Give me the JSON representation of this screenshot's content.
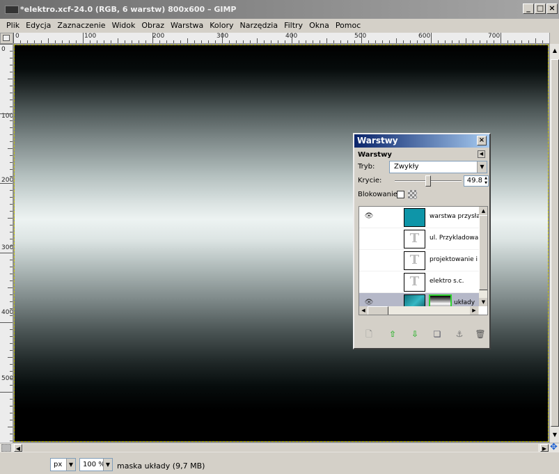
{
  "window": {
    "title": "*elektro.xcf-24.0 (RGB, 6 warstw) 800x600 – GIMP",
    "minimize": "_",
    "maximize": "□",
    "close": "×"
  },
  "menu": [
    "Plik",
    "Edycja",
    "Zaznaczenie",
    "Widok",
    "Obraz",
    "Warstwa",
    "Kolory",
    "Narzędzia",
    "Filtry",
    "Okna",
    "Pomoc"
  ],
  "hruler": [
    "0",
    "100",
    "200",
    "300",
    "400",
    "500",
    "600",
    "700"
  ],
  "vruler": [
    "0",
    "100",
    "200",
    "300",
    "400",
    "500"
  ],
  "statusbar": {
    "unit": "px",
    "zoom": "100 %",
    "message": "maska układy (9,7 MB)"
  },
  "layers_dialog": {
    "title": "Warstwy",
    "tab_label": "Warstwy",
    "mode_label": "Tryb:",
    "mode_value": "Zwykły",
    "opacity_label": "Krycie:",
    "opacity_value": "49.8",
    "lock_label": "Blokowanie:",
    "layers": [
      {
        "name": "warstwa przysła",
        "visible": true,
        "thumb": "teal"
      },
      {
        "name": "ul. Przykladowa",
        "visible": false,
        "thumb": "text"
      },
      {
        "name": "projektowanie i",
        "visible": false,
        "thumb": "text"
      },
      {
        "name": "elektro s.c.",
        "visible": false,
        "thumb": "text"
      },
      {
        "name": "układy",
        "visible": true,
        "thumb": "circuit",
        "selected": true
      }
    ],
    "buttons": [
      "new-layer",
      "raise-layer",
      "lower-layer",
      "duplicate-layer",
      "anchor-layer",
      "delete-layer"
    ]
  },
  "colors": {
    "canvas_bg": "#8b8b8b",
    "teal_layer": "#0e95a8",
    "mask_border": "#2fd12f",
    "title_gradient_start": "#0a246a"
  }
}
